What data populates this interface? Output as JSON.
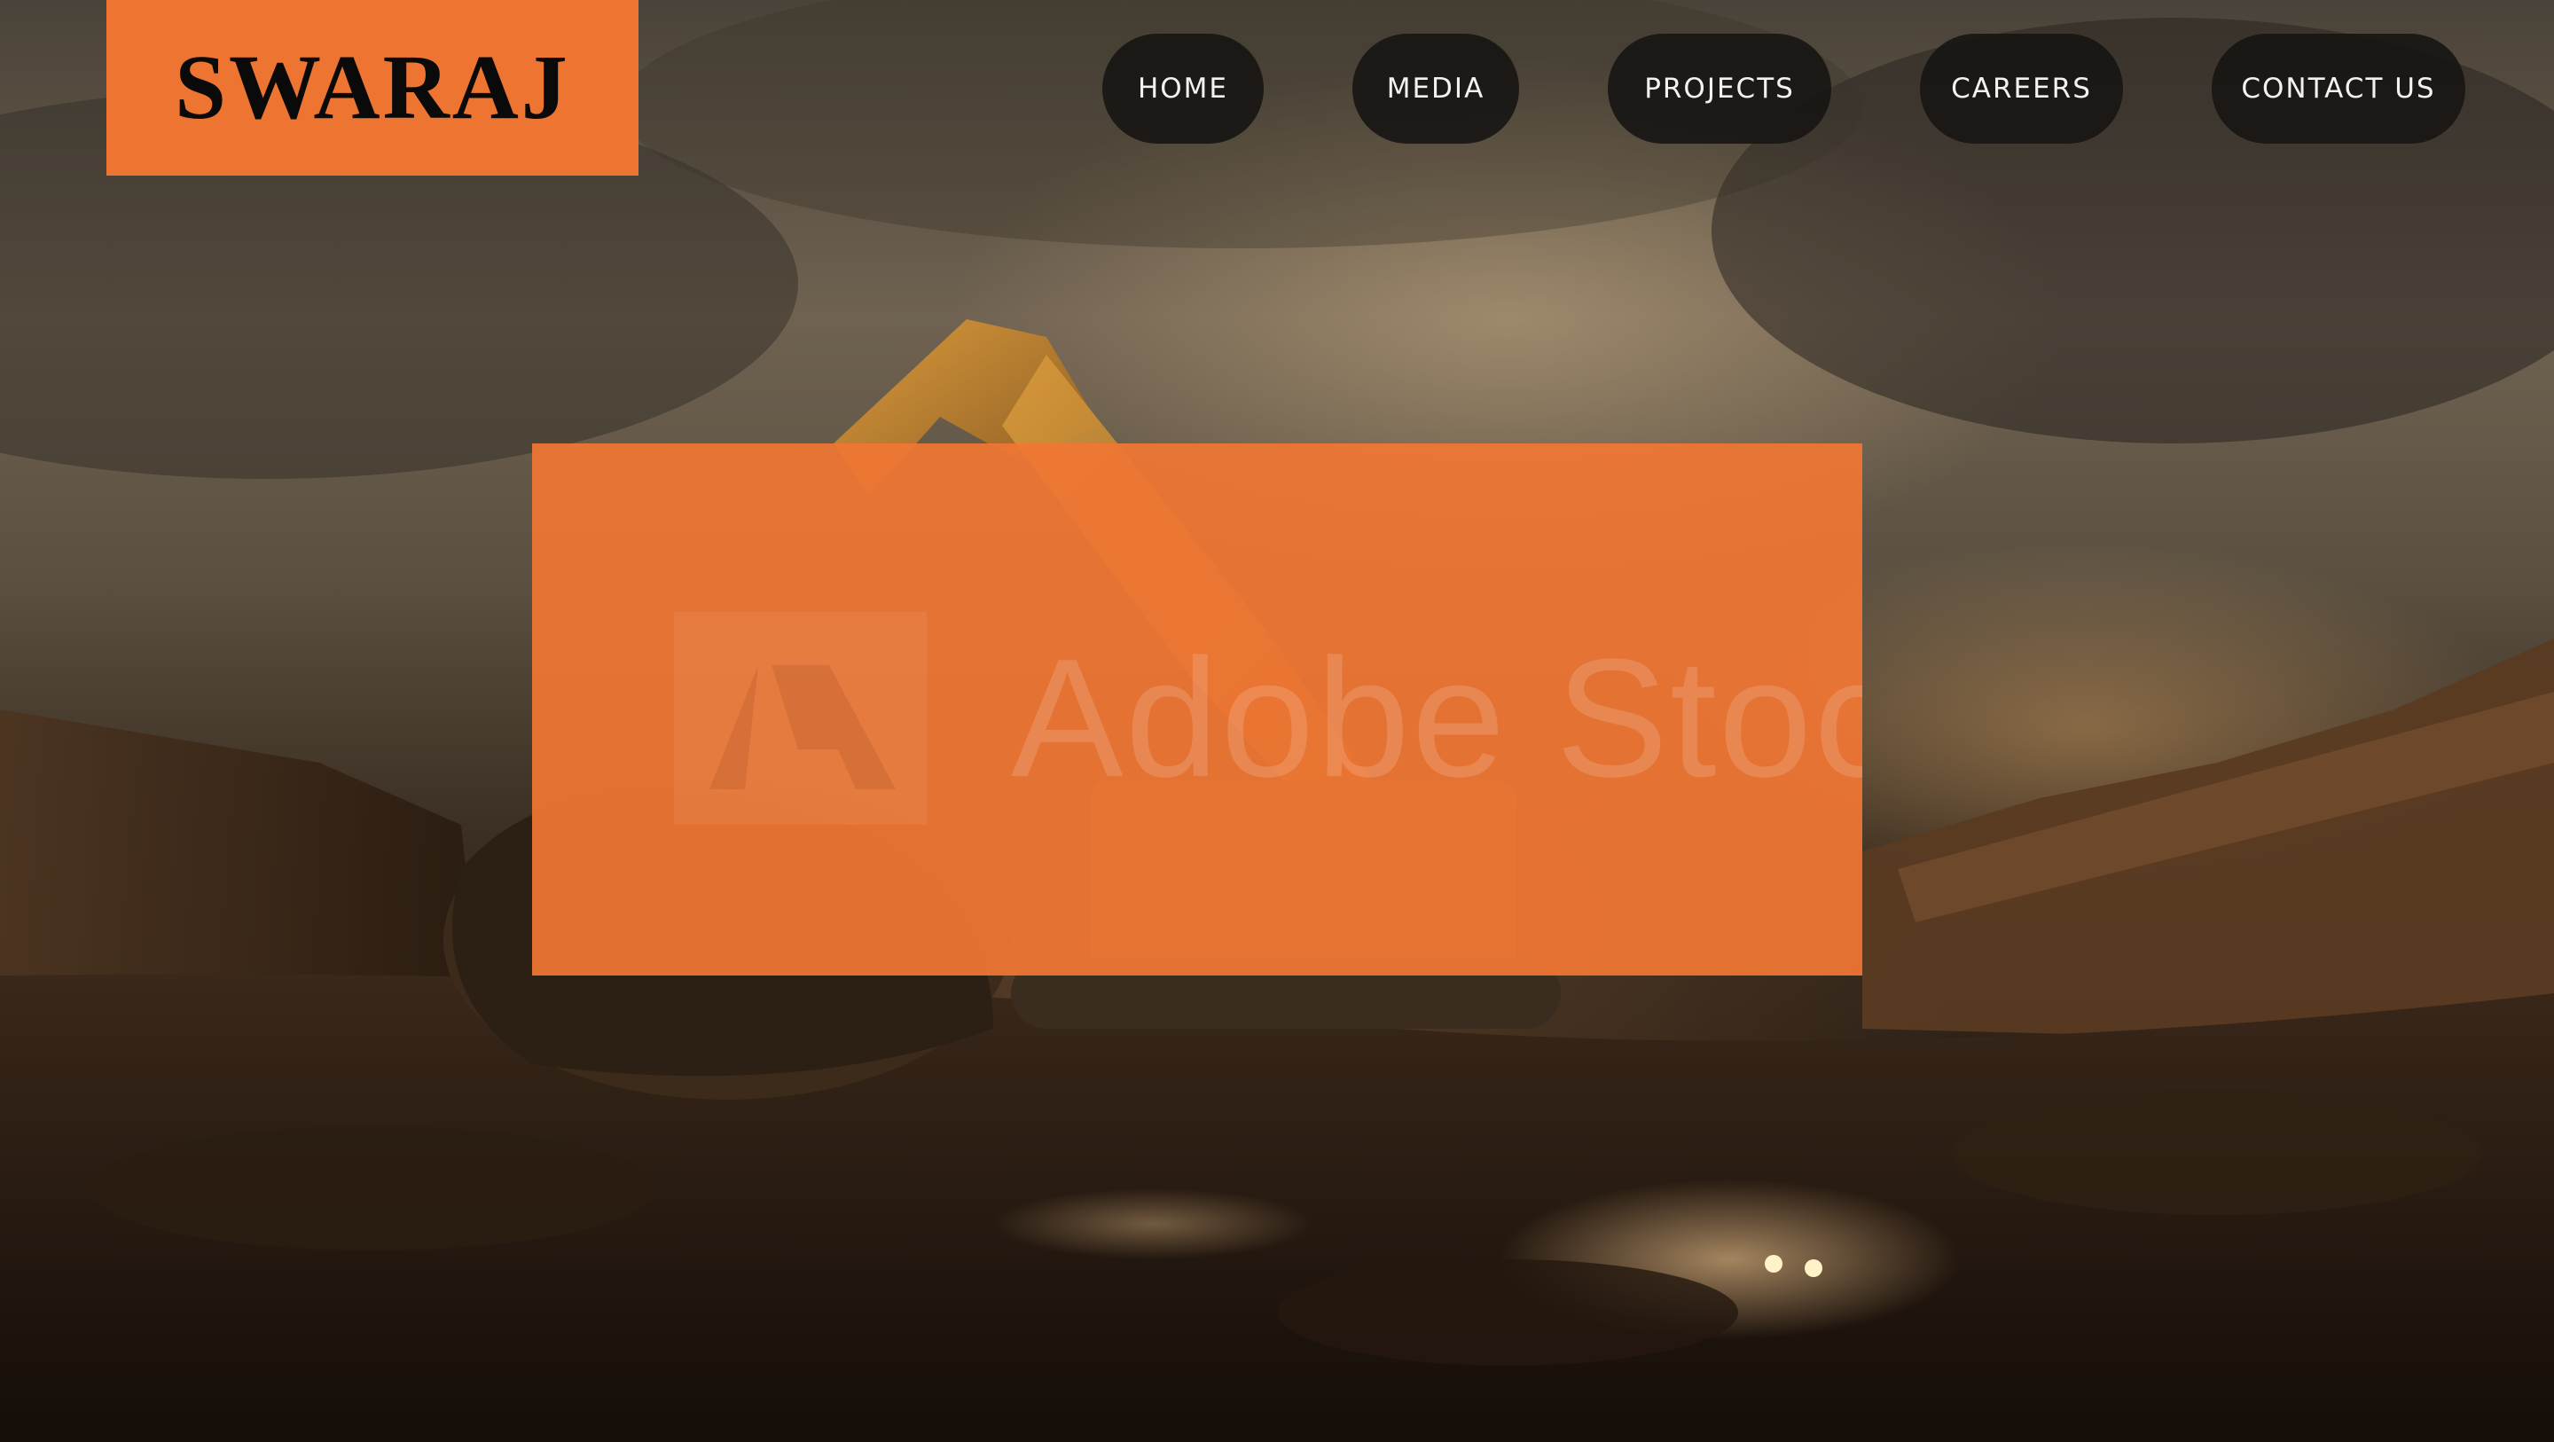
{
  "brand": {
    "name": "SWARAJ",
    "accent_color": "#ee7432",
    "text_color": "#0a0a0a"
  },
  "nav": {
    "items": [
      {
        "label": "HOME"
      },
      {
        "label": "MEDIA"
      },
      {
        "label": "PROJECTS"
      },
      {
        "label": "CAREERS"
      },
      {
        "label": "CONTACT US"
      }
    ],
    "button_bg": "#181614",
    "button_text": "#f2f2f2"
  },
  "hero": {
    "background_image": "construction-site-excavator-photo",
    "overlay_color": "#f07634",
    "watermark": {
      "text": "Adobe Stock",
      "icon": "adobe-stock-logo-icon"
    }
  }
}
